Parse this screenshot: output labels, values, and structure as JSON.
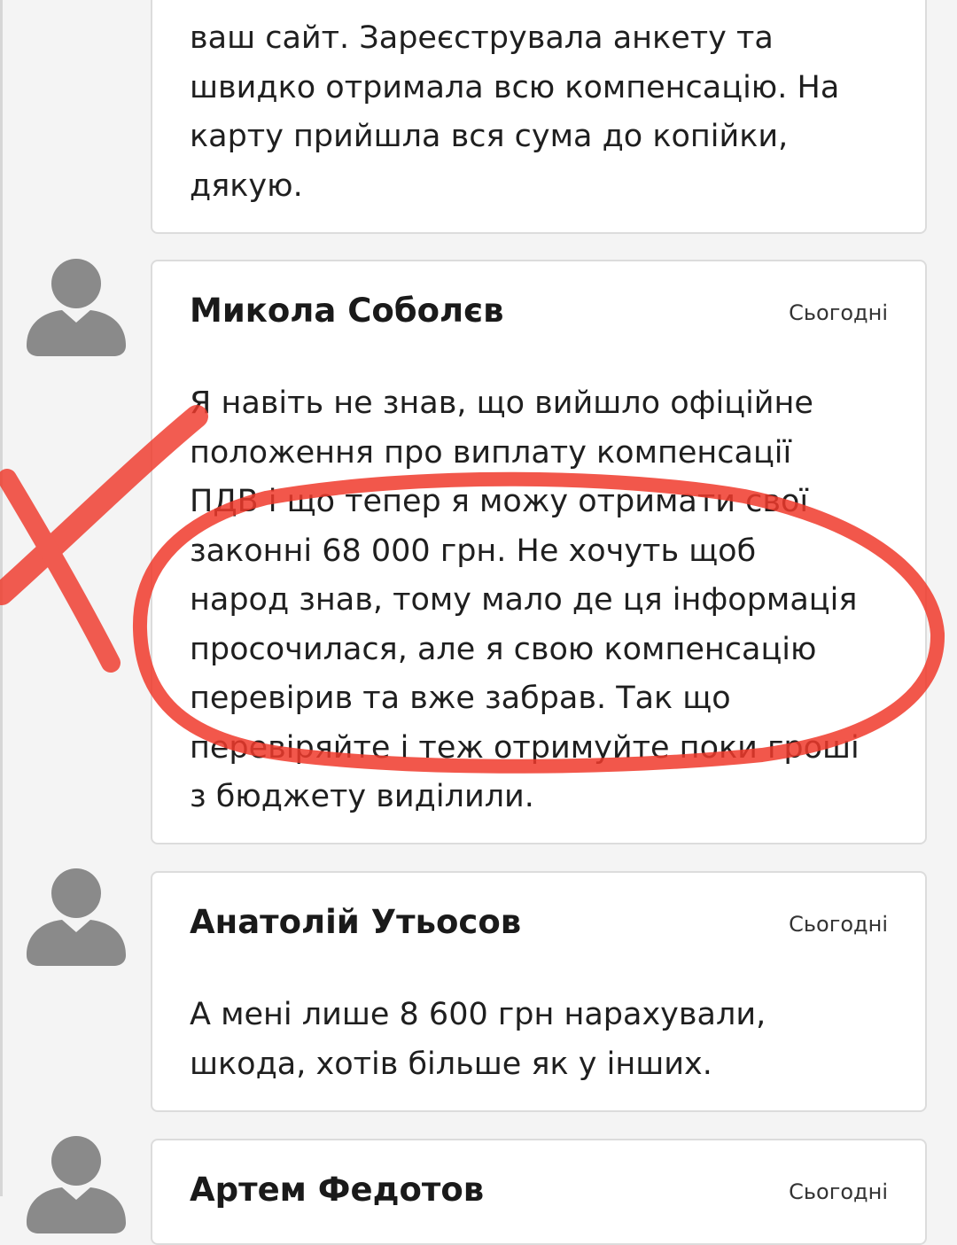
{
  "comments": [
    {
      "body": "ваш сайт. Зареєструвала анкету та\nшвидко отримала всю компенсацію. На\nкарту прийшла вся сума до копійки,\nдякую."
    },
    {
      "author": "Микола Соболєв",
      "date": "Сьогодні",
      "body": "Я навіть не знав, що вийшло офіційне\nположення про виплату компенсації\nПДВ і що тепер я можу отримати свої\nзаконні 68 000 грн. Не хочуть щоб\nнарод знав, тому мало де ця інформація\nпросочилася, але я свою компенсацію\nперевірив та вже забрав. Так що\nперевіряйте і теж отримуйте поки гроші\nз бюджету виділили."
    },
    {
      "author": "Анатолій Утьосов",
      "date": "Сьогодні",
      "body": "А мені лише 8 600 грн нарахували,\nшкода, хотів більше як у інших."
    },
    {
      "author": "Артем Федотов",
      "date": "Сьогодні"
    }
  ],
  "annotation": {
    "color": "#f0392b",
    "marks": [
      "red-cross-mark",
      "red-circle-mark"
    ]
  }
}
